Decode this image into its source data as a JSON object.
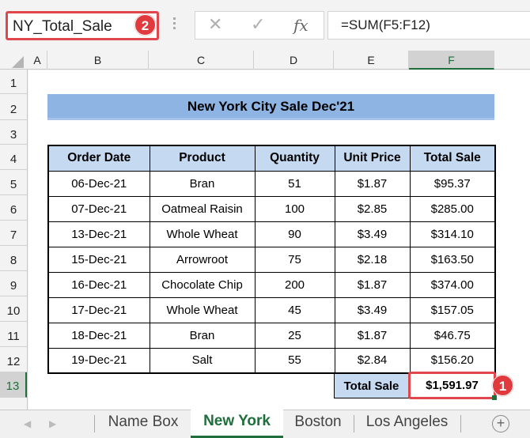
{
  "formula_bar": {
    "name_box": "NY_Total_Sale",
    "cancel_icon": "✕",
    "enter_icon": "✓",
    "fx_icon": "fx",
    "formula": "=SUM(F5:F12)"
  },
  "badges": {
    "name_box_badge": "2",
    "total_cell_badge": "1"
  },
  "columns": [
    "A",
    "B",
    "C",
    "D",
    "E",
    "F"
  ],
  "selected_column": "F",
  "rows": [
    "1",
    "2",
    "3",
    "4",
    "5",
    "6",
    "7",
    "8",
    "9",
    "10",
    "11",
    "12",
    "13"
  ],
  "selected_row": "13",
  "sheet": {
    "title": "New York City Sale Dec'21",
    "headers": [
      "Order Date",
      "Product",
      "Quantity",
      "Unit Price",
      "Total Sale"
    ],
    "records": [
      [
        "06-Dec-21",
        "Bran",
        "51",
        "$1.87",
        "$95.37"
      ],
      [
        "07-Dec-21",
        "Oatmeal Raisin",
        "100",
        "$2.85",
        "$285.00"
      ],
      [
        "13-Dec-21",
        "Whole Wheat",
        "90",
        "$3.49",
        "$314.10"
      ],
      [
        "15-Dec-21",
        "Arrowroot",
        "75",
        "$2.18",
        "$163.50"
      ],
      [
        "16-Dec-21",
        "Chocolate Chip",
        "200",
        "$1.87",
        "$374.00"
      ],
      [
        "17-Dec-21",
        "Whole Wheat",
        "45",
        "$3.49",
        "$157.05"
      ],
      [
        "18-Dec-21",
        "Bran",
        "25",
        "$1.87",
        "$46.75"
      ],
      [
        "19-Dec-21",
        "Salt",
        "55",
        "$2.84",
        "$156.20"
      ]
    ],
    "total_label": "Total Sale",
    "total_value": "$1,591.97"
  },
  "tabs": {
    "prev_icon": "◀",
    "next_icon": "▶",
    "items": [
      "Name Box",
      "New York",
      "Boston",
      "Los Angeles"
    ],
    "active": "New York",
    "add_icon": "+"
  }
}
